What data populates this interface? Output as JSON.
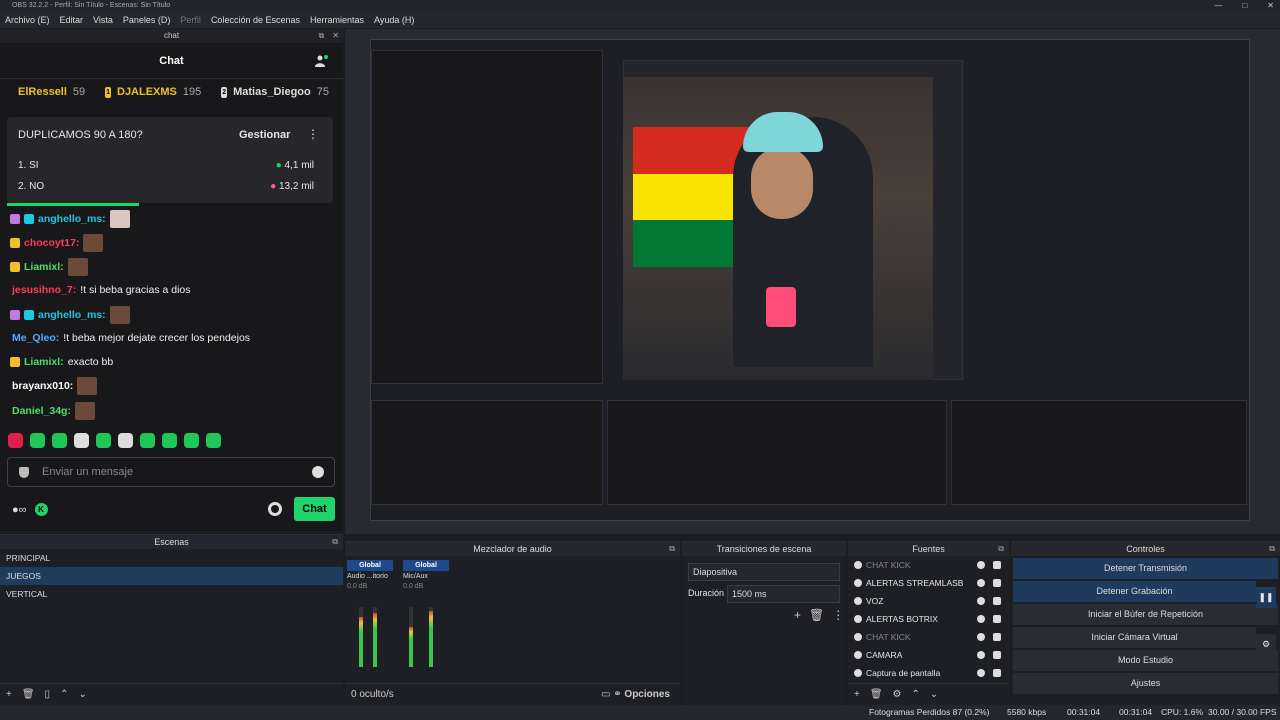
{
  "window_title": "OBS 32.2.2 - Perfil: Sin Título - Escenas: Sin Título",
  "menu": [
    "Archivo (E)",
    "Editar",
    "Vista",
    "Paneles (D)",
    "Perfil",
    "Colección de Escenas",
    "Herramientas",
    "Ayuda (H)"
  ],
  "chat_dock": {
    "dock_title": "chat",
    "header": "Chat",
    "leaders": [
      {
        "name": "ElRessell",
        "count": "59",
        "color": "#f0c02a"
      },
      {
        "name": "DJALEXMS",
        "count": "195",
        "color": "#f0c02a"
      },
      {
        "name": "Matias_Diegoo",
        "count": "75",
        "color": "#dddddd"
      }
    ],
    "poll": {
      "question": "DUPLICAMOS 90 A 180?",
      "manage": "Gestionar",
      "options": [
        {
          "label": "1. SI",
          "value": "4,1 mil"
        },
        {
          "label": "2. NO",
          "value": "13,2 mil"
        }
      ]
    },
    "messages": [
      {
        "user": "anghello_ms:",
        "color": "#1ec8e0",
        "text": ""
      },
      {
        "user": "chocoyt17:",
        "color": "#ff3a5a",
        "text": ""
      },
      {
        "user": "Liamixl:",
        "color": "#4ee06a",
        "text": ""
      },
      {
        "user": "jesusihno_7:",
        "color": "#ff3a5a",
        "text": "!t si beba gracias a dios"
      },
      {
        "user": "anghello_ms:",
        "color": "#1ec8e0",
        "text": ""
      },
      {
        "user": "Me_Qleo:",
        "color": "#58a8ff",
        "text": "!t beba mejor dejate crecer los pendejos"
      },
      {
        "user": "Liamixl:",
        "color": "#4ee06a",
        "text": "exacto bb"
      },
      {
        "user": "brayanx010:",
        "color": "#ffffff",
        "text": ""
      },
      {
        "user": "Daniel_34g:",
        "color": "#4ee06a",
        "text": ""
      }
    ],
    "input_placeholder": "Enviar un mensaje",
    "send": "Chat"
  },
  "scenes": {
    "title": "Escenas",
    "items": [
      "PRINCIPAL",
      "JUEGOS",
      "VERTICAL"
    ],
    "selected": 1
  },
  "mixer": {
    "title": "Mezclador de audio",
    "channels": [
      {
        "head": "Global",
        "name": "Audio ...itorio",
        "db": "0.0 dB"
      },
      {
        "head": "Global",
        "name": "Mic/Aux",
        "db": "0.0 dB"
      }
    ],
    "footer": "0 oculto/s",
    "options": "Opciones"
  },
  "transitions": {
    "title": "Transiciones de escena",
    "type": "Diapositiva",
    "duration_label": "Duración",
    "duration": "1500 ms"
  },
  "sources": {
    "title": "Fuentes",
    "items": [
      {
        "name": "CHAT KICK",
        "dim": true
      },
      {
        "name": "ALERTAS STREAMLASB",
        "dim": false
      },
      {
        "name": "VOZ",
        "dim": false
      },
      {
        "name": "ALERTAS BOTRIX",
        "dim": false
      },
      {
        "name": "CHAT KICK",
        "dim": true
      },
      {
        "name": "CAMARA",
        "dim": false
      },
      {
        "name": "Captura de pantalla",
        "dim": false
      }
    ]
  },
  "controls": {
    "title": "Controles",
    "buttons": [
      "Detener Transmisión",
      "Detener Grabación",
      "Iniciar el Búfer de Repetición",
      "Iniciar Cámara Virtual",
      "Modo Estudio",
      "Ajustes"
    ]
  },
  "status": {
    "dropped": "Fotogramas Perdidos 87 (0.2%)",
    "kbps": "5580 kbps",
    "live": "00:31:04",
    "rec": "00:31:04",
    "cpu": "CPU: 1.6%",
    "fps": "30.00 / 30.00 FPS"
  },
  "colors": {
    "kick_green": "#1fd46a",
    "selected": "#1e3d5c"
  }
}
